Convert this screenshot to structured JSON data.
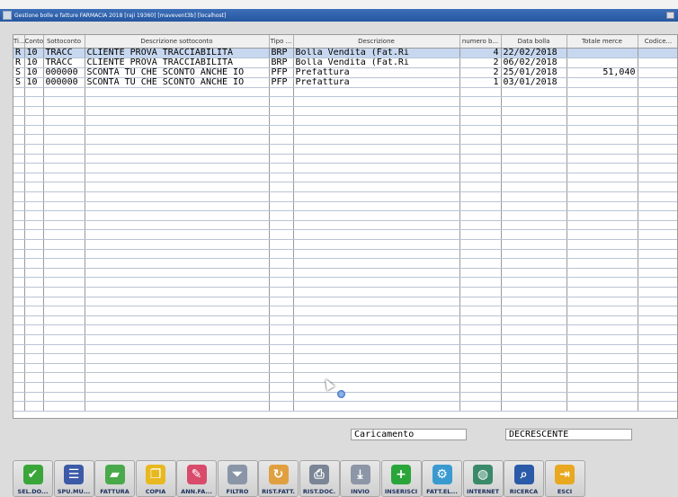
{
  "window": {
    "title": "Gestione bolle e fatture FARMACIA 2018 [raji 19360] [mavevent3b] [localhost]"
  },
  "table": {
    "columns": [
      "Ti...",
      "Conto",
      "Sottoconto",
      "Descrizione sottoconto",
      "Tipo ...",
      "Descrizione",
      "numero b...",
      "Data bolla",
      "Totale merce",
      "Codice..."
    ],
    "rows": [
      {
        "tipo": "R",
        "conto": "10",
        "sottoconto": "TRACC",
        "descr_sottoconto": "CLIENTE PROVA TRACCIABILITA",
        "tipo_doc": "BRP",
        "descrizione": "Bolla Vendita      (Fat.Ri",
        "numero": "4",
        "data": "22/02/2018",
        "totale": "",
        "codice": ""
      },
      {
        "tipo": "R",
        "conto": "10",
        "sottoconto": "TRACC",
        "descr_sottoconto": "CLIENTE PROVA TRACCIABILITA",
        "tipo_doc": "BRP",
        "descrizione": "Bolla Vendita      (Fat.Ri",
        "numero": "2",
        "data": "06/02/2018",
        "totale": "",
        "codice": ""
      },
      {
        "tipo": "S",
        "conto": "10",
        "sottoconto": "000000",
        "descr_sottoconto": "SCONTA TU CHE SCONTO ANCHE IO",
        "tipo_doc": "PFP",
        "descrizione": "Prefattura",
        "numero": "2",
        "data": "25/01/2018",
        "totale": "51,040",
        "codice": ""
      },
      {
        "tipo": "S",
        "conto": "10",
        "sottoconto": "000000",
        "descr_sottoconto": "SCONTA TU CHE SCONTO ANCHE IO",
        "tipo_doc": "PFP",
        "descrizione": "Prefattura",
        "numero": "1",
        "data": "03/01/2018",
        "totale": "",
        "codice": ""
      }
    ],
    "selected_row": 0
  },
  "status": {
    "left": "Caricamento",
    "right": "DECRESCENTE"
  },
  "toolbar": [
    {
      "label": "SEL.DO...",
      "icon": "check-icon",
      "color": "#3aa63a",
      "glyph": "✔"
    },
    {
      "label": "SPU.MU...",
      "icon": "checklist-icon",
      "color": "#3c5aa8",
      "glyph": "☰"
    },
    {
      "label": "FATTURA",
      "icon": "folder-icon",
      "color": "#4aa94a",
      "glyph": "▰"
    },
    {
      "label": "COPIA",
      "icon": "copy-icon",
      "color": "#e8b820",
      "glyph": "❐"
    },
    {
      "label": "ANN.FA...",
      "icon": "eraser-icon",
      "color": "#d94b6a",
      "glyph": "✎"
    },
    {
      "label": "FILTRO",
      "icon": "funnel-icon",
      "color": "#8a96a8",
      "glyph": "⏷"
    },
    {
      "label": "RIST.FATT.",
      "icon": "reprint-invoice-icon",
      "color": "#e0a040",
      "glyph": "↻"
    },
    {
      "label": "RIST.DOC.",
      "icon": "printer-icon",
      "color": "#7a8596",
      "glyph": "⎙"
    },
    {
      "label": "INVIO",
      "icon": "send-tray-icon",
      "color": "#8d96a6",
      "glyph": "⤓"
    },
    {
      "label": "INSERISCI",
      "icon": "plus-icon",
      "color": "#2aa53a",
      "glyph": "+"
    },
    {
      "label": "FATT.EL...",
      "icon": "electronic-invoice-icon",
      "color": "#3a9ad0",
      "glyph": "⚙"
    },
    {
      "label": "INTERNET",
      "icon": "globe-icon",
      "color": "#3a8a6a",
      "glyph": "◍"
    },
    {
      "label": "RICERCA",
      "icon": "magnifier-icon",
      "color": "#2b5aa8",
      "glyph": "⌕"
    },
    {
      "label": "ESCI",
      "icon": "exit-door-icon",
      "color": "#e8a820",
      "glyph": "⇥"
    }
  ]
}
